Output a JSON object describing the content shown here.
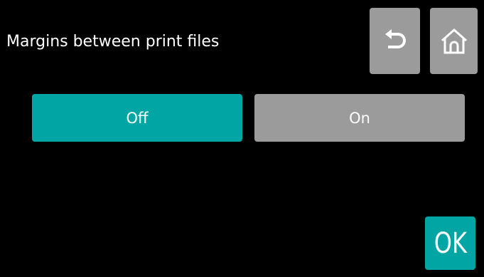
{
  "header": {
    "title": "Margins between print files",
    "back_icon": "undo-arrow-icon",
    "home_icon": "home-icon"
  },
  "options": [
    {
      "label": "Off",
      "selected": true
    },
    {
      "label": "On",
      "selected": false
    }
  ],
  "footer": {
    "ok_label": "OK"
  },
  "colors": {
    "background": "#000000",
    "selected": "#00a5a4",
    "unselected": "#9b9b9b",
    "icon_button": "#9b9b9b",
    "ok_button": "#00a5a4",
    "text": "#ffffff"
  }
}
